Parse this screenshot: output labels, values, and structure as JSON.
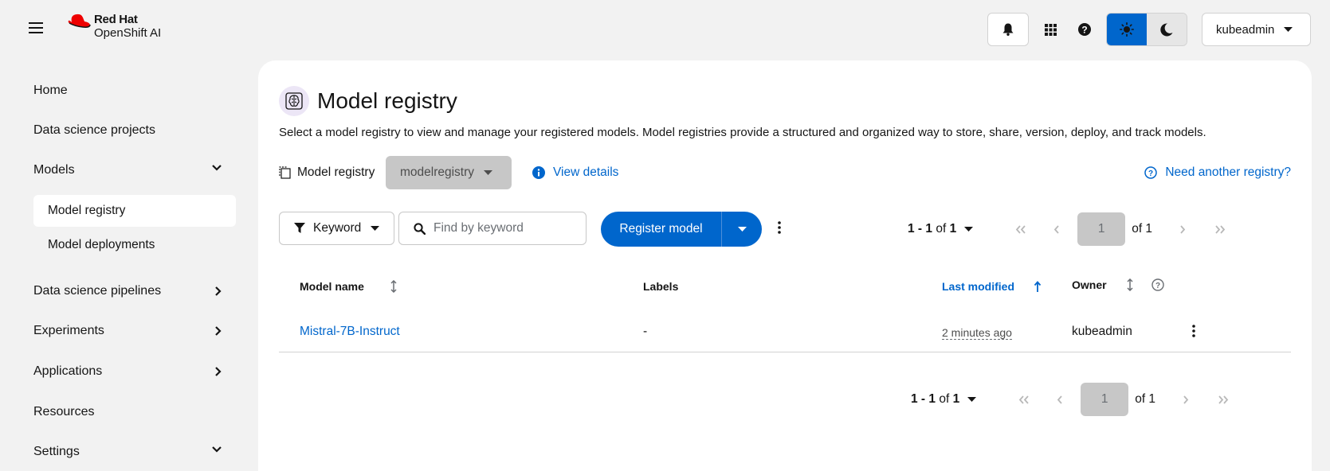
{
  "masthead": {
    "brand_line1": "Red Hat",
    "brand_line2": "OpenShift AI",
    "user": "kubeadmin",
    "colors": {
      "brand_red": "#ee0000",
      "accent": "#0066cc"
    },
    "icons": [
      "hamburger-icon",
      "bell-icon",
      "grid-icon",
      "help-icon",
      "sun-icon",
      "moon-icon"
    ]
  },
  "sidebar": {
    "items": [
      {
        "label": "Home"
      },
      {
        "label": "Data science projects"
      },
      {
        "label": "Models",
        "expanded": true
      },
      {
        "label": "Data science pipelines"
      },
      {
        "label": "Experiments"
      },
      {
        "label": "Applications"
      },
      {
        "label": "Resources"
      },
      {
        "label": "Settings",
        "expanded": true
      }
    ],
    "models_sub": [
      {
        "label": "Model registry",
        "active": true
      },
      {
        "label": "Model deployments"
      }
    ]
  },
  "page": {
    "title": "Model registry",
    "description": "Select a model registry to view and manage your registered models. Model registries provide a structured and organized way to store, share, version, deploy, and track models.",
    "registry_label": "Model registry",
    "registry_value": "modelregistry",
    "view_details": "View details",
    "need_another": "Need another registry?"
  },
  "toolbar": {
    "filter_label": "Keyword",
    "search_placeholder": "Find by keyword",
    "register_label": "Register model",
    "pagination": {
      "range": "1 - 1",
      "of": "of",
      "total": "1",
      "page": "1",
      "of_pages": "of 1"
    }
  },
  "table": {
    "columns": {
      "name": "Model name",
      "labels": "Labels",
      "modified": "Last modified",
      "owner": "Owner"
    },
    "rows": [
      {
        "name": "Mistral-7B-Instruct",
        "labels": "-",
        "modified": "2 minutes ago",
        "owner": "kubeadmin"
      }
    ]
  }
}
